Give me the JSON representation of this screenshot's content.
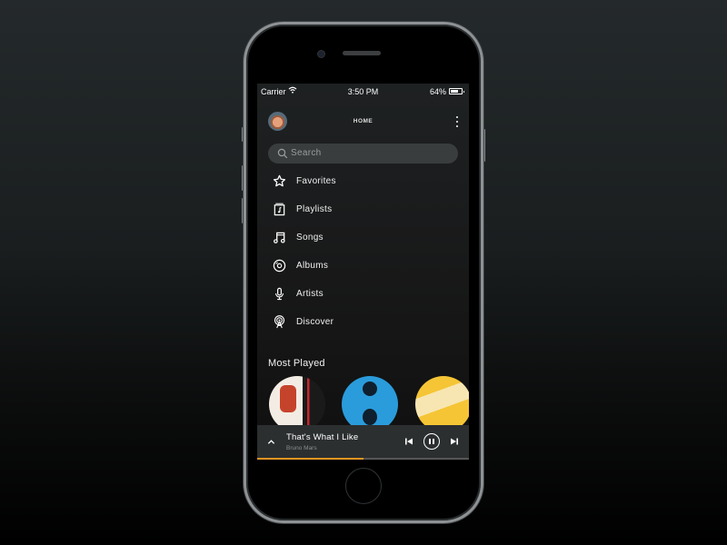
{
  "status_bar": {
    "carrier": "Carrier",
    "wifi_icon": "wifi-icon",
    "time": "3:50 PM",
    "battery_percent": "64%",
    "battery_icon": "battery-icon"
  },
  "header": {
    "title": "HOME",
    "avatar_icon": "user-avatar",
    "more_icon": "kebab-menu-icon"
  },
  "search": {
    "placeholder": "Search",
    "icon": "search-icon"
  },
  "menu": {
    "items": [
      {
        "label": "Favorites",
        "icon": "star-icon"
      },
      {
        "label": "Playlists",
        "icon": "playlist-icon"
      },
      {
        "label": "Songs",
        "icon": "music-note-icon"
      },
      {
        "label": "Albums",
        "icon": "disc-icon"
      },
      {
        "label": "Artists",
        "icon": "microphone-icon"
      },
      {
        "label": "Discover",
        "icon": "broadcast-icon"
      }
    ]
  },
  "most_played": {
    "title": "Most Played",
    "albums": [
      {
        "name": "album-cover-1"
      },
      {
        "name": "album-cover-2"
      },
      {
        "name": "album-cover-3"
      }
    ]
  },
  "now_playing": {
    "song": "That's What I Like",
    "artist": "Bruno Mars",
    "progress_percent": 50,
    "accent_color": "#e39320"
  }
}
